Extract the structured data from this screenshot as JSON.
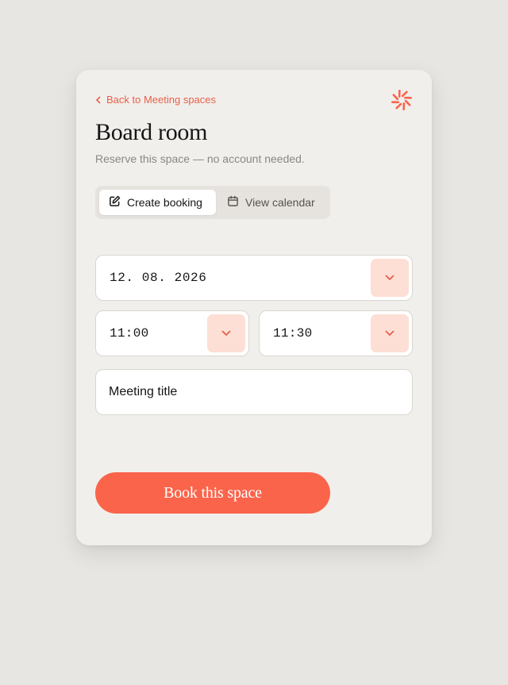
{
  "colors": {
    "accent": "#fa644b",
    "link": "#e8604a",
    "page_background": "#e8e6e2",
    "card_background": "#f1efec",
    "dropdown_tint": "#fddfd5"
  },
  "header": {
    "back_label": "Back to Meeting spaces",
    "back_icon": "chevron-left-icon",
    "logo_icon": "sunburst-logo"
  },
  "page": {
    "title": "Board room",
    "subtitle": "Reserve this space — no account needed."
  },
  "tabs": [
    {
      "label": "Create booking",
      "icon": "edit-icon",
      "active": true
    },
    {
      "label": "View calendar",
      "icon": "calendar-icon",
      "active": false
    }
  ],
  "form": {
    "date": {
      "value": "12. 08. 2026"
    },
    "start_time": {
      "value": "11:00"
    },
    "end_time": {
      "value": "11:30"
    },
    "meeting_title": {
      "placeholder": "Meeting title",
      "value": ""
    },
    "submit_label": "Book this space"
  }
}
